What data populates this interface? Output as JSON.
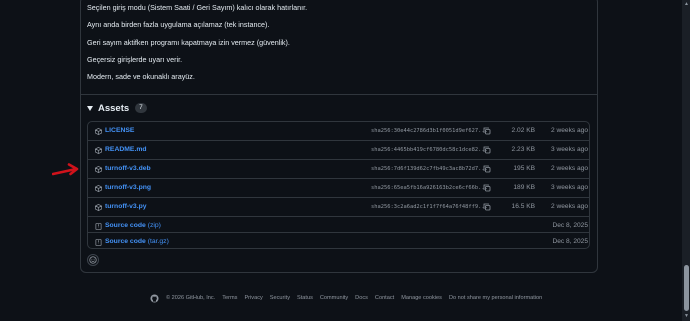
{
  "notes": [
    "Seçilen giriş modu (Sistem Saati / Geri Sayım) kalıcı olarak hatırlanır.",
    "Aynı anda birden fazla uygulama açılamaz (tek instance).",
    "Geri sayım aktifken programı kapatmaya izin vermez (güvenlik).",
    "Geçersiz girişlerde uyarı verir.",
    "Modern, sade ve okunaklı arayüz."
  ],
  "assets": {
    "title": "Assets",
    "count": "7",
    "items": [
      {
        "name": "LICENSE",
        "sha": "sha256:30e44c2786d3b1f0051d9ef627...",
        "size": "2.02 KB",
        "date": "2 weeks ago"
      },
      {
        "name": "README.md",
        "sha": "sha256:4465bb419cf6780dc58c1dce82...",
        "size": "2.23 KB",
        "date": "3 weeks ago"
      },
      {
        "name": "turnoff-v3.deb",
        "sha": "sha256:7d6f139d62c7fb49c3ac8b72d7...",
        "size": "195 KB",
        "date": "2 weeks ago"
      },
      {
        "name": "turnoff-v3.png",
        "sha": "sha256:65ea5fb16a926163b2ce6cf66b...",
        "size": "189 KB",
        "date": "3 weeks ago"
      },
      {
        "name": "turnoff-v3.py",
        "sha": "sha256:3c2a6ad2c1f1f7f64a76f48ff9...",
        "size": "16.5 KB",
        "date": "2 weeks ago"
      }
    ],
    "source": [
      {
        "name": "Source code",
        "ext": "(zip)",
        "date": "Dec 8, 2025"
      },
      {
        "name": "Source code",
        "ext": "(tar.gz)",
        "date": "Dec 8, 2025"
      }
    ]
  },
  "footer": {
    "copyright": "© 2026 GitHub, Inc.",
    "links": [
      "Terms",
      "Privacy",
      "Security",
      "Status",
      "Community",
      "Docs",
      "Contact",
      "Manage cookies",
      "Do not share my personal information"
    ]
  },
  "colors": {
    "background": "#0d1117",
    "border": "#30363d",
    "link": "#4493f8",
    "muted": "#9198a1",
    "annotation_arrow": "#d0121b"
  }
}
